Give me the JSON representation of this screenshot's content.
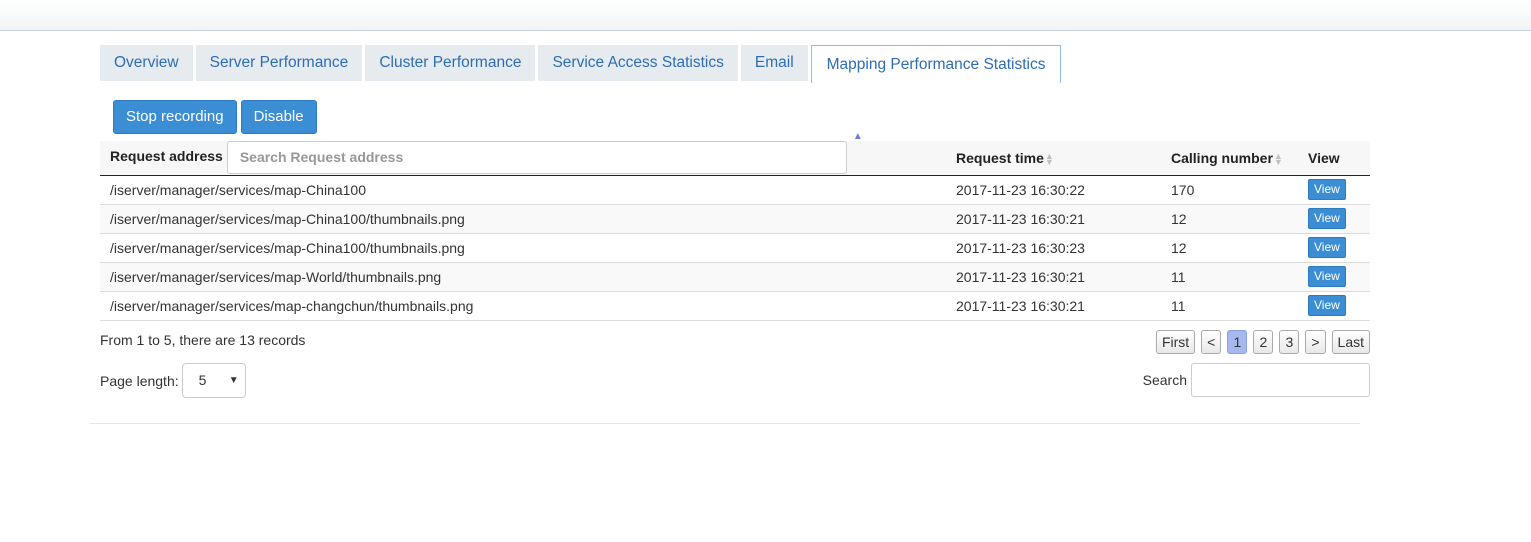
{
  "tabs": [
    {
      "label": "Overview"
    },
    {
      "label": "Server Performance"
    },
    {
      "label": "Cluster Performance"
    },
    {
      "label": "Service Access Statistics"
    },
    {
      "label": "Email"
    },
    {
      "label": "Mapping Performance Statistics"
    }
  ],
  "toolbar": {
    "stop_label": "Stop recording",
    "disable_label": "Disable"
  },
  "table": {
    "headers": {
      "address": "Request address",
      "address_search_placeholder": "Search Request address",
      "time": "Request time",
      "calls": "Calling number",
      "view": "View"
    },
    "rows": [
      {
        "address": "/iserver/manager/services/map-China100",
        "time": "2017-11-23 16:30:22",
        "calls": "170",
        "view": "View"
      },
      {
        "address": "/iserver/manager/services/map-China100/thumbnails.png",
        "time": "2017-11-23 16:30:21",
        "calls": "12",
        "view": "View"
      },
      {
        "address": "/iserver/manager/services/map-China100/thumbnails.png",
        "time": "2017-11-23 16:30:23",
        "calls": "12",
        "view": "View"
      },
      {
        "address": "/iserver/manager/services/map-World/thumbnails.png",
        "time": "2017-11-23 16:30:21",
        "calls": "11",
        "view": "View"
      },
      {
        "address": "/iserver/manager/services/map-changchun/thumbnails.png",
        "time": "2017-11-23 16:30:21",
        "calls": "11",
        "view": "View"
      }
    ]
  },
  "footer": {
    "info": "From 1 to 5, there are 13 records",
    "page_length_label": "Page length:",
    "page_length_value": "5",
    "search_label": "Search"
  },
  "pager": {
    "first": "First",
    "prev": "<",
    "pages": [
      "1",
      "2",
      "3"
    ],
    "next": ">",
    "last": "Last",
    "current": "1"
  }
}
